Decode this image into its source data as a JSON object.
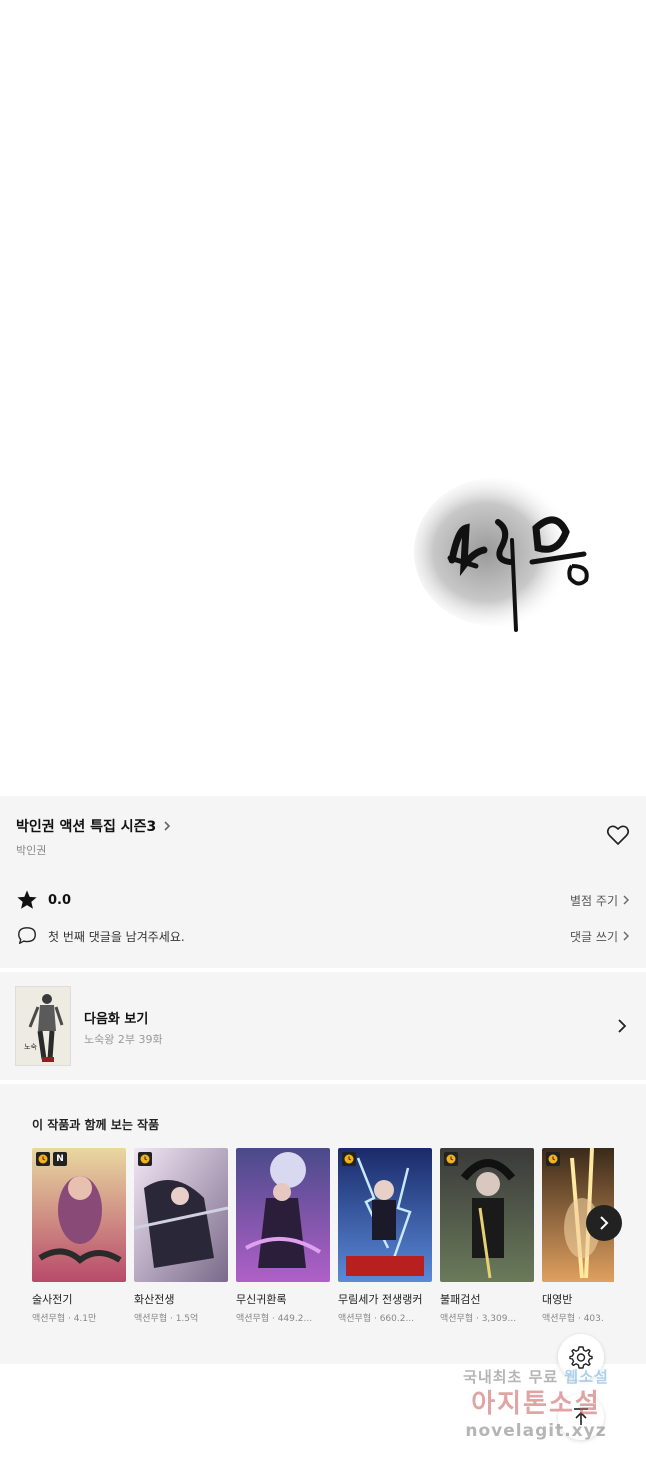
{
  "series": {
    "title": "박인권 액션 특집 시즌3",
    "author": "박인권"
  },
  "rating": {
    "value": "0.0",
    "action_label": "별점 주기"
  },
  "comments": {
    "prompt": "첫 번째 댓글을 남겨주세요.",
    "action_label": "댓글 쓰기"
  },
  "next_episode": {
    "label": "다음화 보기",
    "subtitle": "노숙왕 2부 39화"
  },
  "recommendations": {
    "title": "이 작품과 함께 보는 작품",
    "items": [
      {
        "title": "술사전기",
        "meta": "액션무협 · 4.1만",
        "badges": [
          "clock",
          "N"
        ]
      },
      {
        "title": "화산전생",
        "meta": "액션무협 · 1.5억",
        "badges": [
          "clock"
        ]
      },
      {
        "title": "무신귀환록",
        "meta": "액션무협 · 449.2...",
        "badges": []
      },
      {
        "title": "무림세가 전생랭커",
        "meta": "액션무협 · 660.2...",
        "badges": [
          "clock"
        ]
      },
      {
        "title": "불패검선",
        "meta": "액션무협 · 3,309...",
        "badges": [
          "clock"
        ]
      },
      {
        "title": "대영반",
        "meta": "액션무협 · 403.",
        "badges": [
          "clock"
        ]
      }
    ]
  },
  "watermark": {
    "line1a": "국내최초 무료",
    "line1b": "웹소설",
    "line2": "아지톤소설",
    "line3": "novelagit.xyz"
  },
  "icons": {
    "series_chevron": "chevron-right-icon",
    "favorite": "heart-icon",
    "rating": "star-icon",
    "comment": "speech-bubble-icon",
    "settings": "gear-icon",
    "scroll_top": "arrow-up-icon"
  }
}
